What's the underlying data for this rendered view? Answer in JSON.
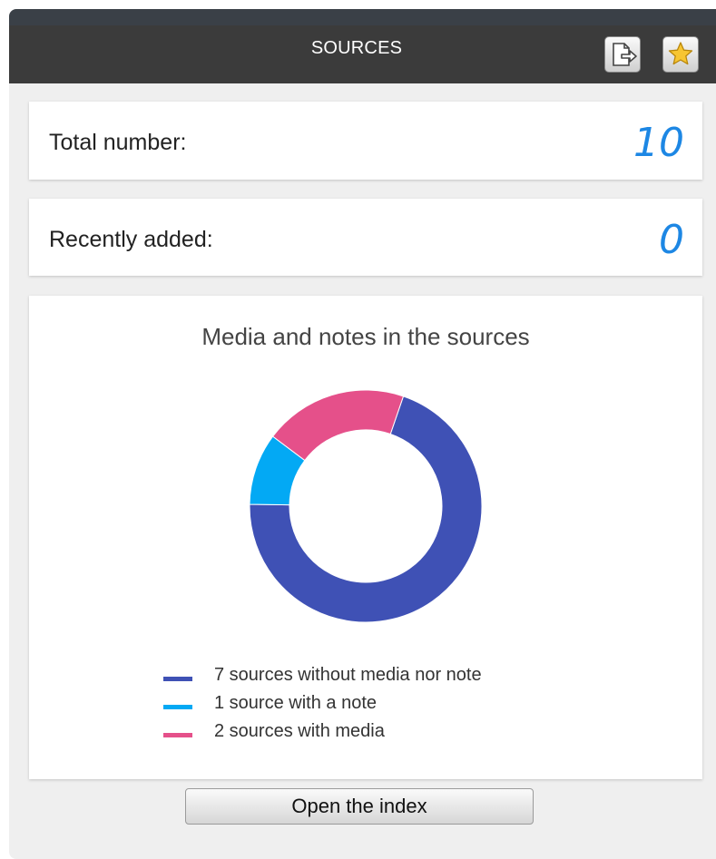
{
  "header": {
    "title": "SOURCES",
    "export_icon": "export-page-icon",
    "favorite_icon": "star-icon"
  },
  "stats": [
    {
      "label": "Total number:",
      "value": "10"
    },
    {
      "label": "Recently added:",
      "value": "0"
    }
  ],
  "chart_data": {
    "type": "pie",
    "style": "donut",
    "title": "Media and notes in the sources",
    "categories": [
      "7 sources without media nor note",
      "1 source with a note",
      "2 sources with media"
    ],
    "values": [
      7,
      1,
      2
    ],
    "colors": [
      "#3f51b5",
      "#03a9f4",
      "#e5508a"
    ],
    "legend_position": "bottom"
  },
  "footer": {
    "button_label": "Open the index"
  }
}
